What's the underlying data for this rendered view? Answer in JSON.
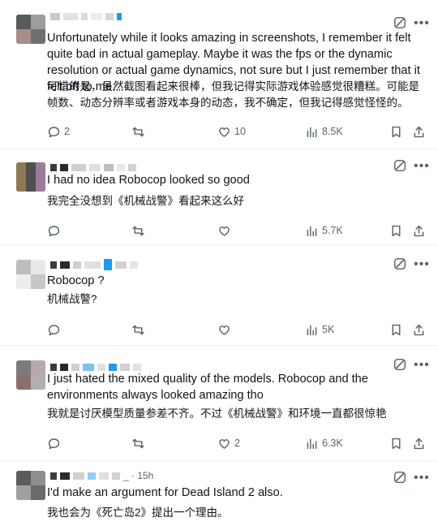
{
  "tweets": [
    {
      "header_text": "",
      "text_en": "Unfortunately while it looks amazing in screenshots, I remember it felt quite bad in actual gameplay. Maybe it was the fps or the dynamic resolution or actual game dynamics, not sure but I just remember that it felt off to me.",
      "text_zh": "可惜的是，虽然截图看起来很棒，但我记得实际游戏体验感觉很糟糕。可能是帧数、动态分辨率或者游戏本身的动态，我不确定，但我记得感觉怪怪的。",
      "replies": "2",
      "reposts": "",
      "likes": "10",
      "views": "8.5K"
    },
    {
      "header_text": "",
      "text_en": "I had no idea Robocop looked so good",
      "text_zh": "我完全没想到《机械战警》看起来这么好",
      "replies": "",
      "reposts": "",
      "likes": "",
      "views": "5.7K"
    },
    {
      "header_text": "",
      "text_en": "Robocop ?",
      "text_zh": "机械战警?",
      "replies": "",
      "reposts": "",
      "likes": "",
      "views": "5K"
    },
    {
      "header_text": "",
      "text_en": "I just hated the mixed quality of the models. Robocop and the environments always looked amazing tho",
      "text_zh": "我就是讨厌模型质量参差不齐。不过《机械战警》和环境一直都很惊艳",
      "replies": "",
      "reposts": "",
      "likes": "2",
      "views": "6.3K"
    },
    {
      "header_text": "_ · 15h",
      "text_en": "I'd make an argument for Dead Island 2 also.",
      "text_zh": "我也会为《死亡岛2》提出一个理由。",
      "replies": "",
      "reposts": "",
      "likes": "",
      "views": ""
    }
  ],
  "icons": {
    "reply": "reply-icon",
    "repost": "repost-icon",
    "like": "heart-icon",
    "views": "views-icon",
    "bookmark": "bookmark-icon",
    "share": "share-icon",
    "grok": "grok-icon",
    "more": "more-icon"
  },
  "colors": {
    "text": "#0f1419",
    "muted": "#536471",
    "border": "#eff3f4",
    "blue_pixel": "#1d9bf0"
  }
}
